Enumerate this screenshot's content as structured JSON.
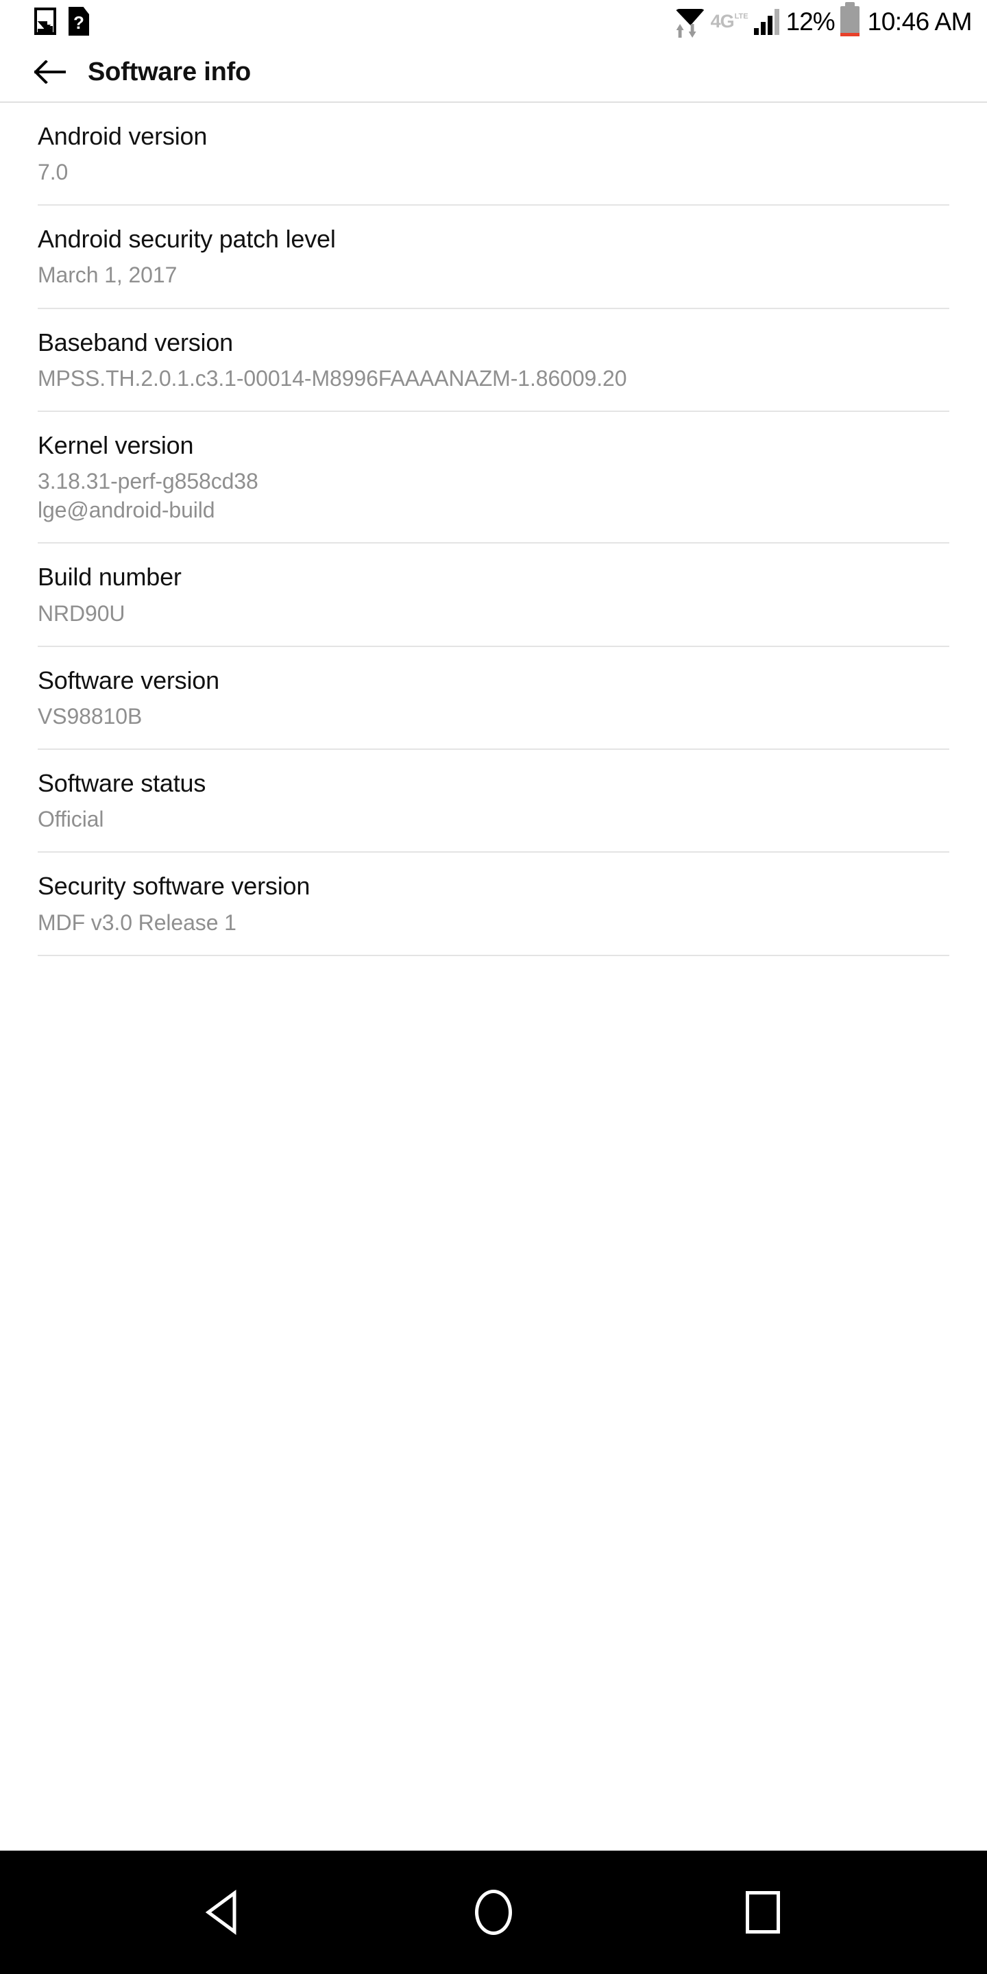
{
  "status_bar": {
    "left_icons": [
      {
        "name": "photo-icon",
        "label": "Screenshot captured"
      },
      {
        "name": "sd-card-unknown-icon",
        "label": "?"
      }
    ],
    "wifi_icon": "wifi-transfer-icon",
    "network_type": "4G",
    "network_type_sub": "LTE",
    "signal_icon": "cellular-signal-icon",
    "battery_percent": "12%",
    "battery_icon": "battery-low-icon",
    "clock": "10:46 AM"
  },
  "app_bar": {
    "back_icon": "arrow-back-icon",
    "title": "Software info"
  },
  "list": {
    "items": [
      {
        "title": "Android version",
        "value": "7.0",
        "value2": ""
      },
      {
        "title": "Android security patch level",
        "value": "March 1, 2017",
        "value2": ""
      },
      {
        "title": "Baseband version",
        "value": "MPSS.TH.2.0.1.c3.1-00014-M8996FAAAANAZM-1.86009.20",
        "value2": ""
      },
      {
        "title": "Kernel version",
        "value": "3.18.31-perf-g858cd38",
        "value2": "lge@android-build"
      },
      {
        "title": "Build number",
        "value": "NRD90U",
        "value2": ""
      },
      {
        "title": "Software version",
        "value": "VS98810B",
        "value2": ""
      },
      {
        "title": "Software status",
        "value": "Official",
        "value2": ""
      },
      {
        "title": "Security software version",
        "value": "MDF v3.0 Release 1",
        "value2": ""
      }
    ]
  },
  "nav_bar": {
    "back": "nav-back-icon",
    "home": "nav-home-icon",
    "recents": "nav-recents-icon"
  },
  "colors": {
    "background": "#ffffff",
    "title_text": "#111111",
    "value_text": "#8f8f8f",
    "divider": "#e4e4e4",
    "navbar_bg": "#000000",
    "battery_low": "#e8412a",
    "network_gray": "#bdbdbd"
  }
}
